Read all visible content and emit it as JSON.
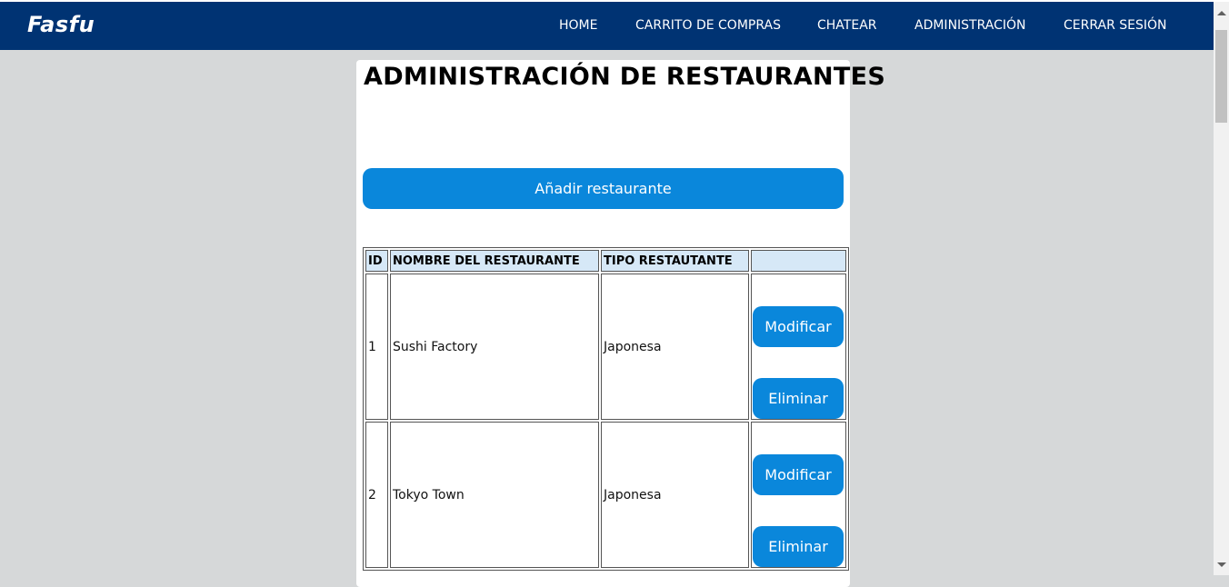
{
  "navbar": {
    "brand": "Fasfu",
    "links": [
      "HOME",
      "CARRITO DE COMPRAS",
      "CHATEAR",
      "ADMINISTRACIÓN",
      "CERRAR SESIÓN"
    ]
  },
  "page": {
    "title": "ADMINISTRACIÓN DE RESTAURANTES",
    "add_button": "Añadir restaurante"
  },
  "table": {
    "headers": [
      "ID",
      "NOMBRE DEL RESTAURANTE",
      "TIPO RESTAUTANTE",
      ""
    ],
    "rows": [
      {
        "id": "1",
        "name": "Sushi Factory",
        "type": "Japonesa",
        "modify": "Modificar",
        "delete": "Eliminar"
      },
      {
        "id": "2",
        "name": "Tokyo Town",
        "type": "Japonesa",
        "modify": "Modificar",
        "delete": "Eliminar"
      }
    ]
  },
  "colors": {
    "navbar": "#003373",
    "button": "#0a87db",
    "header_cell": "#d6e8f7",
    "background": "#d6d8d9"
  }
}
